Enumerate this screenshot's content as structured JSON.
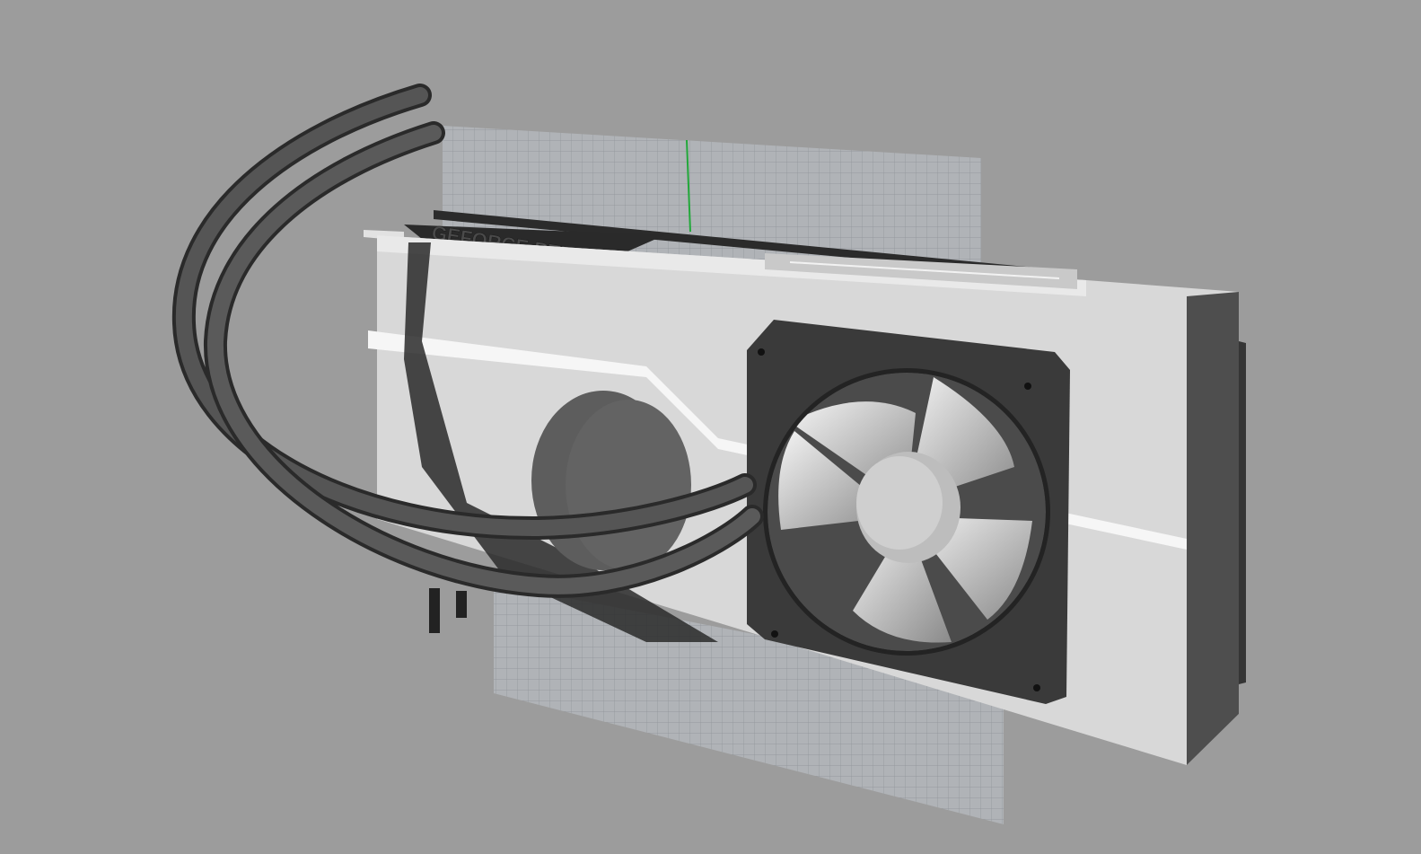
{
  "viewport": {
    "background": "#9c9c9c",
    "gridColor": "#aeb1b5",
    "gridLineColor": "#8d9196",
    "axisColor": "#22a83a"
  },
  "model": {
    "shroudLabel": "GEFORCE RTX",
    "shroudColor": "#d7d7d7",
    "fanFrameColor": "#3a3a3a",
    "tubeColor": "#4a4a4a"
  }
}
